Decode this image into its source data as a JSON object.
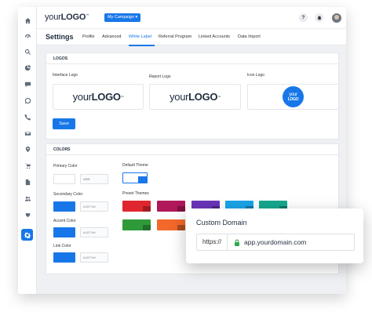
{
  "sidebar": {
    "icons": [
      "home-icon",
      "dashboard-icon",
      "search-icon",
      "pie-chart-icon",
      "chat-icon",
      "whatsapp-icon",
      "phone-icon",
      "mail-icon",
      "location-icon",
      "cart-icon",
      "document-icon",
      "users-icon",
      "plug-icon",
      "settings-icon"
    ],
    "active": "settings-icon"
  },
  "topbar": {
    "logo_prefix": "your",
    "logo_bold": "LOGO",
    "logo_tm": "™",
    "campaign_label": "My Campaign ▾",
    "help_label": "?",
    "bell_label": "🔔"
  },
  "page": {
    "title": "Settings",
    "tabs": [
      "Profile",
      "Advanced",
      "White Label",
      "Referral Program",
      "Linked Accounts",
      "Data Import"
    ],
    "active_tab": "White Label"
  },
  "logos": {
    "header": "LOGOS",
    "interface_label": "Interface Logo",
    "report_label": "Report Logo",
    "icon_label": "Icon Logo",
    "logo_prefix": "your",
    "logo_bold": "LOGO",
    "logo_tm": "™",
    "icon_line1": "your",
    "icon_line2": "LOGO",
    "save_label": "Save"
  },
  "colors": {
    "header": "COLORS",
    "primary_label": "Primary Color",
    "primary_hex": "#ffffff",
    "secondary_label": "Secondary Color",
    "secondary_hex": "#1877e8",
    "accent_label": "Accent Color",
    "accent_hex": "#1877e8",
    "link_label": "Link Color",
    "link_hex": "#1877e8",
    "default_theme_label": "Default Theme",
    "preset_themes_label": "Preset Themes",
    "preset_colors": [
      "#e0262e",
      "#b0185a",
      "#6a35b9",
      "#1aa4e8",
      "#16a78e",
      "#2f9a3a",
      "#f2692a"
    ]
  },
  "custom_domain": {
    "title": "Custom Domain",
    "protocol": "https://",
    "url": "app.yourdomain.com"
  }
}
